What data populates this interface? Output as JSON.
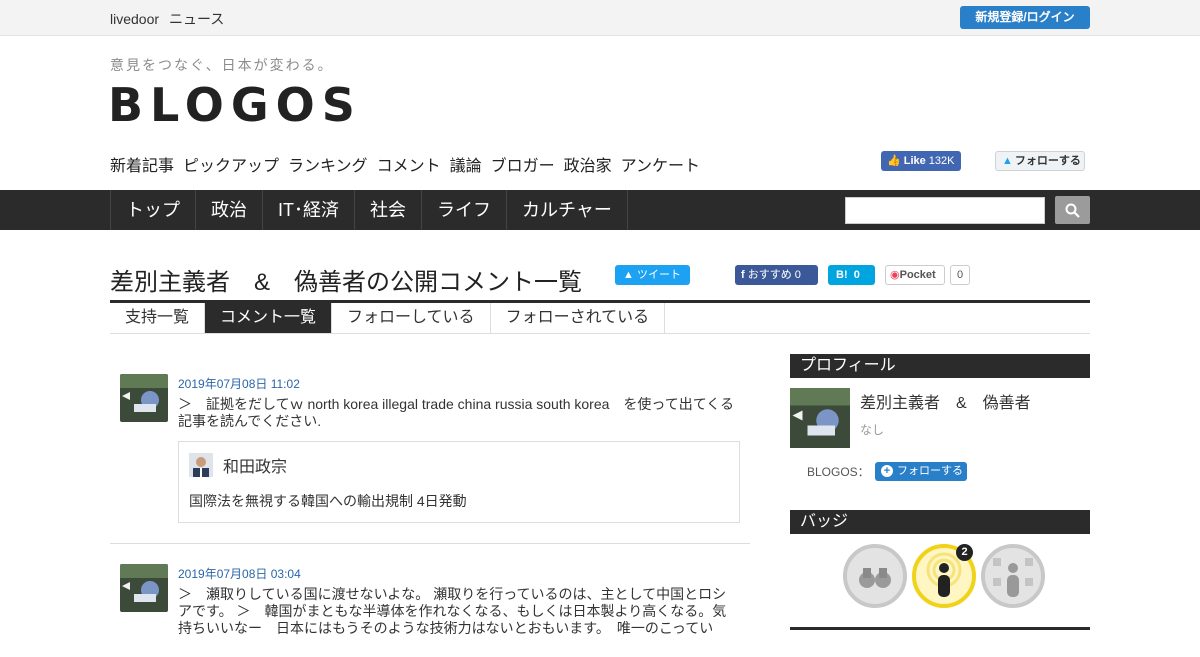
{
  "topbar": {
    "brand_primary": "livedoor",
    "brand_secondary": "ニュース",
    "login_label": "新規登録/ログイン"
  },
  "header": {
    "tagline": "意見をつなぐ、日本が変わる。",
    "logo": "BLOGOS",
    "subnav": [
      "新着記事",
      "ピックアップ",
      "ランキング",
      "コメント",
      "議論",
      "ブロガー",
      "政治家",
      "アンケート"
    ],
    "fb_like_label": "Like",
    "fb_like_count": "132K",
    "twitter_follow_label": "フォローする"
  },
  "mainnav": {
    "items": [
      "トップ",
      "政治",
      "IT･経済",
      "社会",
      "ライフ",
      "カルチャー"
    ],
    "search_placeholder": ""
  },
  "page": {
    "title": "差別主義者　&　偽善者の公開コメント一覧",
    "tweet_label": "ツイート",
    "fb_recommend_label": "おすすめ",
    "fb_recommend_count": "0",
    "hatena_label": "B!",
    "hatena_count": "0",
    "pocket_label": "Pocket",
    "pocket_count": "0"
  },
  "tabs": [
    {
      "label": "支持一覧",
      "active": false
    },
    {
      "label": "コメント一覧",
      "active": true
    },
    {
      "label": "フォローしている",
      "active": false
    },
    {
      "label": "フォローされている",
      "active": false
    }
  ],
  "comments": [
    {
      "date": "2019年07月08日 11:02",
      "text": "＞　証拠をだしてｗ north korea illegal trade china russia south korea　を使って出てくる記事を読んでください.",
      "quote_author": "和田政宗",
      "quote_headline": "国際法を無視する韓国への輸出規制 4日発動"
    },
    {
      "date": "2019年07月08日 03:04",
      "text": "＞　瀬取りしている国に渡せないよな。 瀬取りを行っているのは、主として中国とロシアです。 ＞　韓国がまともな半導体を作れなくなる、もしくは日本製より高くなる。気持ちいいなー　日本にはもうそのような技術力はないとおもいます。　唯一のこってい"
    }
  ],
  "sidebar": {
    "profile_heading": "プロフィール",
    "profile_name": "差別主義者　&　偽善者",
    "profile_desc": "なし",
    "blogos_label": "BLOGOS：",
    "follow_label": "フォローする",
    "badges_heading": "バッジ",
    "badge_count": "2"
  },
  "colors": {
    "nav_dark": "#2b2b2b",
    "accent_blue": "#2a7fc9",
    "date_blue": "#2b65a8",
    "badge_gold": "#f1d21a"
  }
}
